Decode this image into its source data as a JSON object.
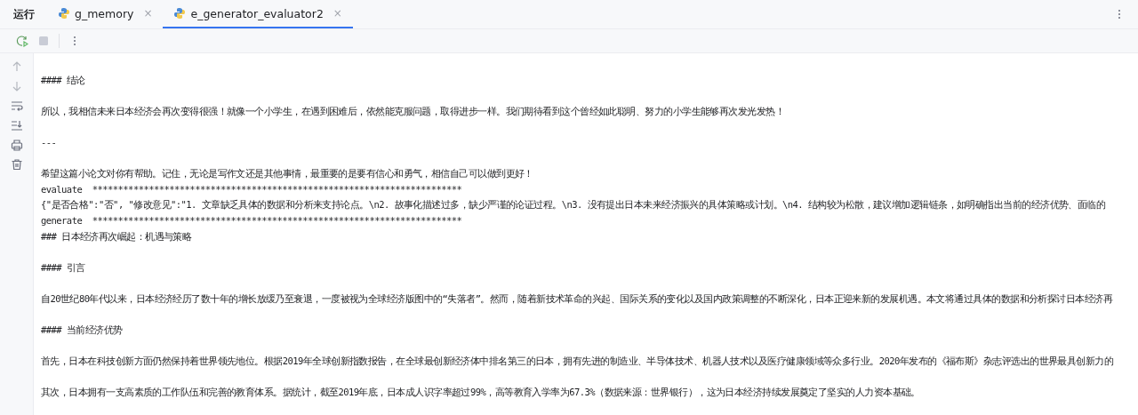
{
  "tool_window": {
    "title": "运行"
  },
  "tabs": [
    {
      "label": "g_memory",
      "close": "×",
      "selected": false
    },
    {
      "label": "e_generator_evaluator2",
      "close": "×",
      "selected": true
    }
  ],
  "console": {
    "lines": [
      {
        "kind": "blank"
      },
      {
        "kind": "text",
        "text": "#### 结论"
      },
      {
        "kind": "blank"
      },
      {
        "kind": "text",
        "text": "所以，我相信未来日本经济会再次变得很强！就像一个小学生，在遇到困难后，依然能克服问题，取得进步一样。我们期待看到这个曾经如此聪明、努力的小学生能够再次发光发热！"
      },
      {
        "kind": "blank"
      },
      {
        "kind": "text",
        "text": "---"
      },
      {
        "kind": "blank"
      },
      {
        "kind": "text",
        "text": "希望这篇小论文对你有帮助。记住，无论是写作文还是其他事情，最重要的是要有信心和勇气，相信自己可以做到更好！"
      },
      {
        "kind": "text",
        "text": "evaluate  ************************************************************************"
      },
      {
        "kind": "text",
        "text": "{\"是否合格\":\"否\", \"修改意见\":\"1. 文章缺乏具体的数据和分析来支持论点。\\n2. 故事化描述过多，缺少严谨的论证过程。\\n3. 没有提出日本未来经济振兴的具体策略或计划。\\n4. 结构较为松散，建议增加逻辑链条，如明确指出当前的经济优势、面临的"
      },
      {
        "kind": "text",
        "text": "generate  ************************************************************************"
      },
      {
        "kind": "text",
        "text": "### 日本经济再次崛起：机遇与策略"
      },
      {
        "kind": "blank"
      },
      {
        "kind": "text",
        "text": "#### 引言"
      },
      {
        "kind": "blank"
      },
      {
        "kind": "text",
        "text": "自20世纪80年代以来，日本经济经历了数十年的增长放缓乃至衰退，一度被视为全球经济版图中的“失落者”。然而，随着新技术革命的兴起、国际关系的变化以及国内政策调整的不断深化，日本正迎来新的发展机遇。本文将通过具体的数据和分析探讨日本经济再"
      },
      {
        "kind": "blank"
      },
      {
        "kind": "text",
        "text": "#### 当前经济优势"
      },
      {
        "kind": "blank"
      },
      {
        "kind": "text",
        "text": "首先，日本在科技创新方面仍然保持着世界领先地位。根据2019年全球创新指数报告，在全球最创新经济体中排名第三的日本，拥有先进的制造业、半导体技术、机器人技术以及医疗健康领域等众多行业。2020年发布的《福布斯》杂志评选出的世界最具创新力的"
      },
      {
        "kind": "blank"
      },
      {
        "kind": "text",
        "text": "其次，日本拥有一支高素质的工作队伍和完善的教育体系。据统计，截至2019年底，日本成人识字率超过99%，高等教育入学率为67.3%（数据来源：世界银行），这为日本经济持续发展奠定了坚实的人力资本基础。"
      }
    ]
  }
}
